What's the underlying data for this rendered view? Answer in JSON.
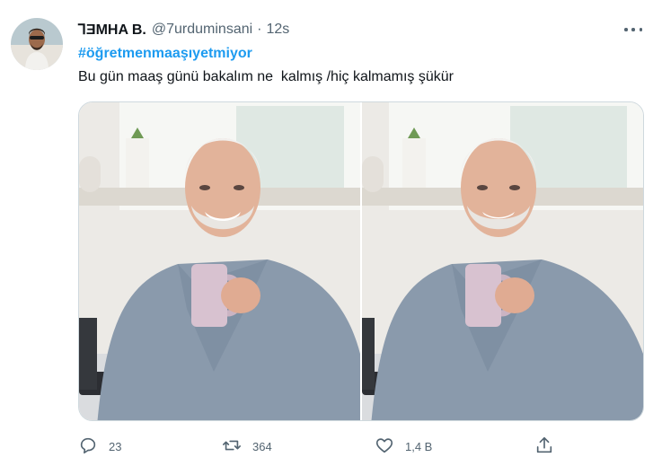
{
  "tweet": {
    "display_name": "ꓶƎMHA B.",
    "handle": "@7urduminsani",
    "separator": "·",
    "time": "12s",
    "hashtag": "#öğretmenmaaşıyetmiyor",
    "text": "Bu gün maaş günü bakalım ne  kalmış /hiç kalmamış şükür"
  },
  "actions": {
    "reply_count": "23",
    "retweet_count": "364",
    "like_count": "1,4 B"
  },
  "icons": {
    "reply": "speech-bubble-icon",
    "retweet": "retweet-icon",
    "like": "heart-icon",
    "share": "share-icon",
    "more": "more-dots-icon"
  },
  "colors": {
    "link": "#1d9bf0",
    "muted": "#536471",
    "text": "#0f1419"
  }
}
